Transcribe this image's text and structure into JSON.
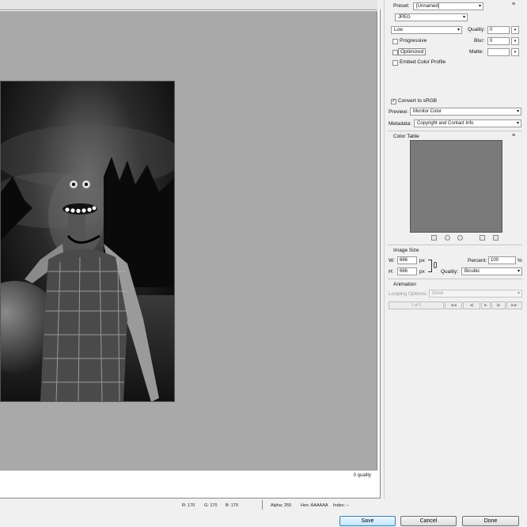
{
  "preview": {
    "quality_label": "0 quality"
  },
  "status": {
    "r": "R: 170",
    "g": "G: 170",
    "b": "B: 170",
    "alpha": "Alpha: 255",
    "hex": "Hex: AAAAAA",
    "index": "Index: --"
  },
  "buttons": {
    "save": "Save",
    "cancel": "Cancel",
    "done": "Done"
  },
  "settings": {
    "preset_label": "Preset:",
    "preset_value": "[Unnamed]",
    "format_value": "JPEG",
    "quality_preset": "Low",
    "quality_label": "Quality:",
    "quality_value": "0",
    "progressive_label": "Progressive",
    "blur_label": "Blur:",
    "blur_value": "0",
    "optimized_label": "Optimized",
    "matte_label": "Matte:",
    "embed_label": "Embed Color Profile",
    "convert_label": "Convert to sRGB",
    "preview_label": "Preview:",
    "preview_value": "Monitor Color",
    "metadata_label": "Metadata:",
    "metadata_value": "Copyright and Contact Info"
  },
  "color_table": {
    "title": "Color Table"
  },
  "image_size": {
    "title": "Image Size",
    "w_label": "W:",
    "w_value": "666",
    "h_label": "H:",
    "h_value": "666",
    "unit": "px",
    "percent_label": "Percent:",
    "percent_value": "100",
    "percent_unit": "%",
    "quality_label": "Quality:",
    "quality_value": "Bicubic"
  },
  "animation": {
    "title": "Animation",
    "looping_label": "Looping Options:",
    "looping_value": "Once",
    "frame_counter": "1 of 1"
  },
  "icons": {
    "checkmark": "✓",
    "dropdown": "▾",
    "menu": "≡"
  }
}
